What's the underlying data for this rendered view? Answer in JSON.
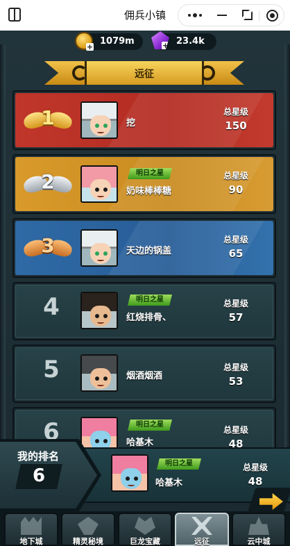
{
  "titlebar": {
    "title": "佣兵小镇"
  },
  "currency": {
    "gold": "1079m",
    "gem": "23.4k"
  },
  "banner": {
    "title": "远征"
  },
  "ranking": [
    {
      "rank": "1",
      "name": "挖",
      "vip": "",
      "score_label": "总星级",
      "score": "150",
      "avatar_icon": "white-hair-hero-avatar"
    },
    {
      "rank": "2",
      "name": "奶味棒棒糖",
      "vip": "明日之星",
      "score_label": "总星级",
      "score": "90",
      "avatar_icon": "pink-hair-hero-avatar"
    },
    {
      "rank": "3",
      "name": "天边的锅盖",
      "vip": "",
      "score_label": "总星级",
      "score": "65",
      "avatar_icon": "white-hair-hero-avatar"
    },
    {
      "rank": "4",
      "name": "红烧排骨、",
      "vip": "明日之星",
      "score_label": "总星级",
      "score": "57",
      "avatar_icon": "bearded-warrior-avatar"
    },
    {
      "rank": "5",
      "name": "烟酒烟酒",
      "vip": "",
      "score_label": "总星级",
      "score": "53",
      "avatar_icon": "headband-warrior-avatar"
    },
    {
      "rank": "6",
      "name": "哈基木",
      "vip": "明日之星",
      "score_label": "总星级",
      "score": "48",
      "avatar_icon": "mermaid-hero-avatar"
    }
  ],
  "my_rank": {
    "label": "我的排名",
    "rank": "6",
    "name": "哈基木",
    "vip": "明日之星",
    "score_label": "总星级",
    "score": "48"
  },
  "nav": {
    "tabs": [
      {
        "label": "地下城",
        "icon": "castle-icon"
      },
      {
        "label": "精灵秘境",
        "icon": "leaf-icon"
      },
      {
        "label": "巨龙宝藏",
        "icon": "dragon-icon"
      },
      {
        "label": "远征",
        "icon": "crossed-swords-icon",
        "active": true
      },
      {
        "label": "云中城",
        "icon": "cloud-castle-icon"
      }
    ]
  },
  "colors": {
    "rank1": "#c0362a",
    "rank2": "#d99a2b",
    "rank3": "#2f6aa6",
    "rank_other": "#23403f",
    "vip_badge": "#6cc23a",
    "banner_gold": "#f2c24a"
  }
}
